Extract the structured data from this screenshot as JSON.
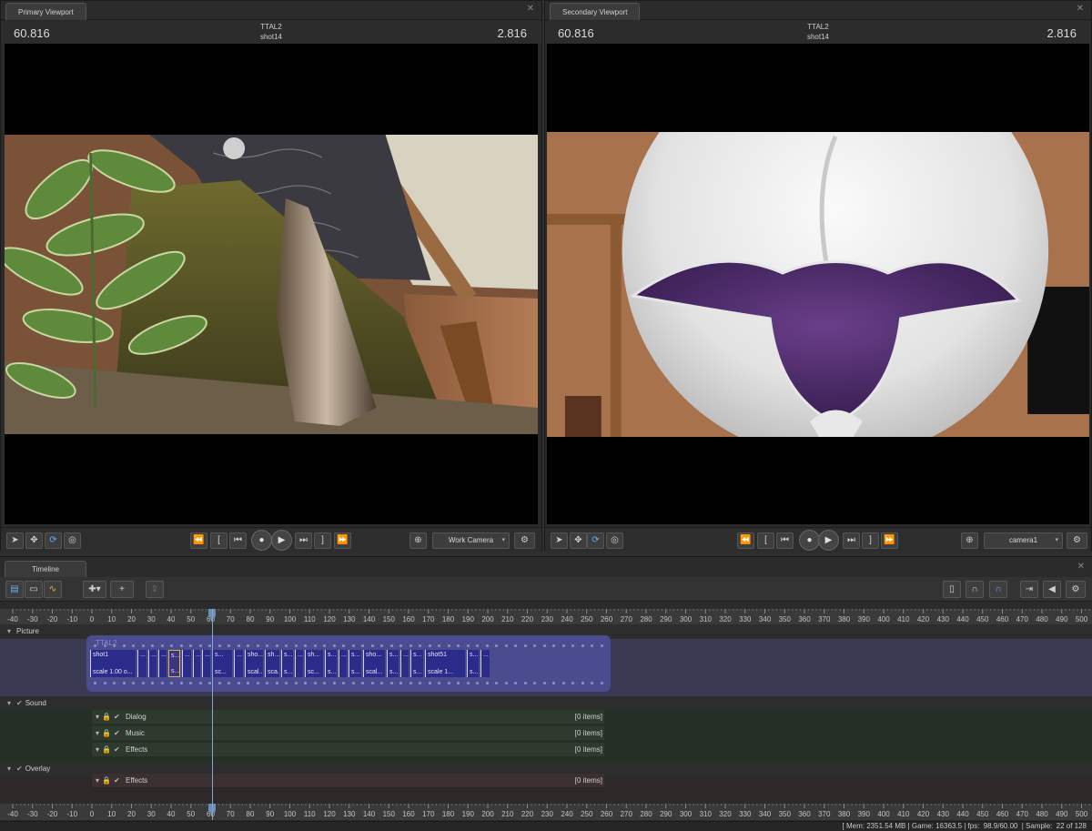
{
  "primary_viewport": {
    "tab": "Primary Viewport",
    "time_left": "60.816",
    "time_right": "2.816",
    "session": "TTAL2",
    "shot": "shot14",
    "camera": "Work Camera"
  },
  "secondary_viewport": {
    "tab": "Secondary Viewport",
    "time_left": "60.816",
    "time_right": "2.816",
    "session": "TTAL2",
    "shot": "shot14",
    "camera": "camera1"
  },
  "timeline": {
    "tab": "Timeline",
    "ruler_ticks": [
      "-40",
      "-30",
      "-20",
      "-10",
      "0",
      "10",
      "20",
      "30",
      "40",
      "50",
      "60",
      "70",
      "80",
      "90",
      "100",
      "110",
      "120",
      "130",
      "140",
      "150",
      "160",
      "170",
      "180",
      "190",
      "200",
      "210",
      "220",
      "230",
      "240",
      "250",
      "260",
      "270",
      "280",
      "290",
      "300",
      "310",
      "320",
      "330",
      "340",
      "350",
      "360",
      "370",
      "380",
      "390",
      "400",
      "410",
      "420",
      "430",
      "440",
      "450",
      "460",
      "470",
      "480",
      "490",
      "500"
    ],
    "picture": {
      "label": "Picture",
      "film_title": "TTAL2",
      "clips": [
        {
          "name": "shot1",
          "scale": "scale 1.00 o..."
        },
        {
          "name": "...",
          "scale": ""
        },
        {
          "name": "...",
          "scale": ""
        },
        {
          "name": "...",
          "scale": ""
        },
        {
          "name": "s...",
          "scale": "s..."
        },
        {
          "name": "...",
          "scale": ""
        },
        {
          "name": "...",
          "scale": ""
        },
        {
          "name": "...",
          "scale": ""
        },
        {
          "name": "s...",
          "scale": "sc..."
        },
        {
          "name": "...",
          "scale": ""
        },
        {
          "name": "sho...",
          "scale": "scal..."
        },
        {
          "name": "sh...",
          "scale": "sca..."
        },
        {
          "name": "s...",
          "scale": "s..."
        },
        {
          "name": "...",
          "scale": ""
        },
        {
          "name": "sh...",
          "scale": "sc..."
        },
        {
          "name": "s...",
          "scale": "s..."
        },
        {
          "name": "...",
          "scale": ""
        },
        {
          "name": "s...",
          "scale": "s..."
        },
        {
          "name": "sho...",
          "scale": "scal..."
        },
        {
          "name": "s...",
          "scale": "s..."
        },
        {
          "name": "...",
          "scale": ""
        },
        {
          "name": "s...",
          "scale": "s..."
        },
        {
          "name": "shot51",
          "scale": "scale 1..."
        },
        {
          "name": "s...",
          "scale": "s..."
        },
        {
          "name": "...",
          "scale": ""
        }
      ]
    },
    "sound": {
      "label": "Sound",
      "tracks": [
        {
          "name": "Dialog",
          "count": "[0 items]"
        },
        {
          "name": "Music",
          "count": "[0 items]"
        },
        {
          "name": "Effects",
          "count": "[0 items]"
        }
      ]
    },
    "overlay": {
      "label": "Overlay",
      "tracks": [
        {
          "name": "Effects",
          "count": "[0 items]"
        }
      ]
    }
  },
  "status": {
    "mem": "[ Mem:  2351.54 MB | Game:  16363.5 | fps:",
    "fps": "98.9/60.00",
    "sample": "| Sample:",
    "sample_count": "22 of 128"
  }
}
